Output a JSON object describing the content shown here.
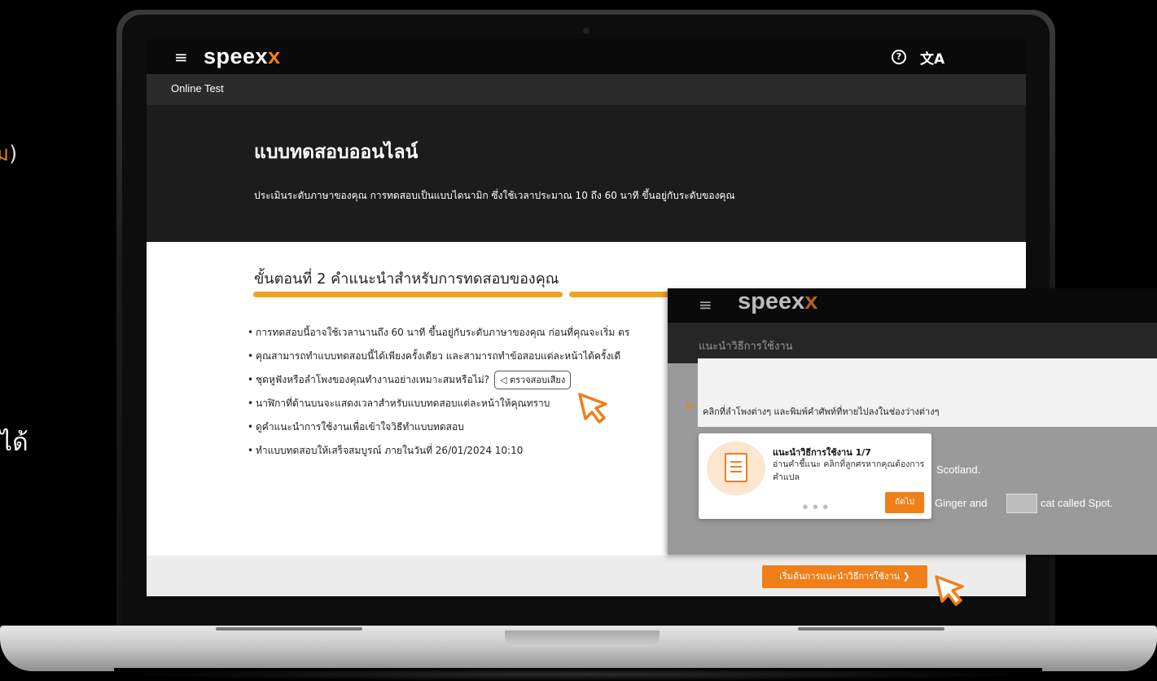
{
  "slide": {
    "fragment_top": "ม",
    "fragment_paren": ")",
    "fragment_bottom": "ได้"
  },
  "app": {
    "brand_main": "speex",
    "brand_x": "x",
    "subheader": "Online Test",
    "help_icon": "help-icon",
    "translate_icon": "translate-icon"
  },
  "hero": {
    "title": "แบบทดสอบออนไลน์",
    "description": "ประเมินระดับภาษาของคุณ การทดสอบเป็นแบบไดนามิก ซึ่งใช้เวลาประมาณ 10 ถึง 60 นาที ขึ้นอยู่กับระดับของคุณ"
  },
  "step": {
    "title": "ขั้นตอนที่ 2 คำแนะนำสำหรับการทดสอบของคุณ",
    "rules": [
      "การทดสอบนี้อาจใช้เวลานานถึง 60 นาที ขึ้นอยู่กับระดับภาษาของคุณ ก่อนที่คุณจะเริ่ม ตร",
      "คุณสามารถทำแบบทดสอบนี้ได้เพียงครั้งเดียว และสามารถทำข้อสอบแต่ละหน้าได้ครั้งเดี",
      "ชุดหูฟังหรือลำโพงของคุณทำงานอย่างเหมาะสมหรือไม่?",
      "นาฬิกาที่ด้านบนจะแสดงเวลาสำหรับแบบทดสอบแต่ละหน้าให้คุณทราบ",
      "ดูคำแนะนำการใช้งานเพื่อเข้าใจวิธีทำแบบทดสอบ",
      "ทำแบบทดสอบให้เสร็จสมบูรณ์ ภายในวันที่ 26/01/2024 10:10"
    ],
    "sound_check": "◁ ตรวจสอบเสียง"
  },
  "footer": {
    "start_button": "เริ่มต้นการแนะนำวิธีการใช้งาน ❯"
  },
  "inset": {
    "brand_main": "speex",
    "brand_x": "x",
    "subheader": "แนะนำวิธีการใช้งาน",
    "instruction_arrows": "⇆",
    "instruction": "คลิกที่ลำโพงต่างๆ และพิมพ์คำศัพท์ที่หายไปลงในช่องว่างต่างๆ",
    "line1": "Scotland.",
    "line2a": "ed Ginger and",
    "line2b": "cat called Spot.",
    "tooltip": {
      "title": "แนะนำวิธีการใช้งาน 1/7",
      "body": "อ่านคำชี้แนะ คลิกที่ลูกศรหากคุณต้องการคำแปล",
      "dots": "● ● ●",
      "next": "ถัดไป"
    }
  },
  "colors": {
    "brand_orange": "#f07f1a",
    "progress_yellow": "#f0a21c",
    "dark_bg": "#1c1c1c"
  }
}
